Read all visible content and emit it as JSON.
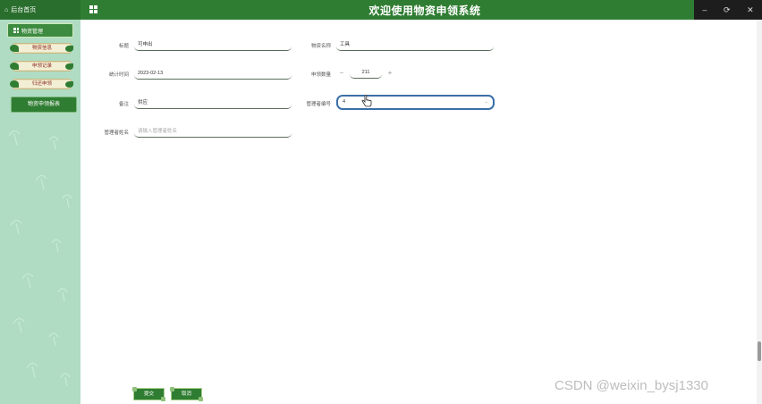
{
  "topbar": {
    "home_label": "后台首页",
    "title": "欢迎使用物资申领系统",
    "minimize_glyph": "–",
    "maximize_glyph": "⟳",
    "close_glyph": "✕"
  },
  "sidebar": {
    "header_label": "物资管理",
    "items": [
      {
        "label": "物资信息"
      },
      {
        "label": "申领记录"
      },
      {
        "label": "归还申领"
      }
    ],
    "active_label": "物资申领报表"
  },
  "form": {
    "title_label": "标题",
    "title_value": "可申出",
    "org_label": "物资名称",
    "org_value": "工具",
    "date_label": "统计时间",
    "date_value": "2023-02-13",
    "qty_label": "申领数量",
    "qty_minus": "−",
    "qty_value": "211",
    "qty_plus": "+",
    "remark_label": "备注",
    "remark_value": "供应",
    "admin_label": "管理者编号",
    "admin_value": "4",
    "admin_arrow": "⌄",
    "reviewer_label": "管理者姓名",
    "reviewer_placeholder": "请输入管理者姓名"
  },
  "actions": {
    "submit_label": "提交",
    "cancel_label": "取消"
  },
  "watermark": "CSDN @weixin_bysj1330",
  "colors": {
    "primary_green": "#2f7d32",
    "sidebar_bg": "#b0dcc3",
    "focus_blue": "#3a6fa8"
  }
}
